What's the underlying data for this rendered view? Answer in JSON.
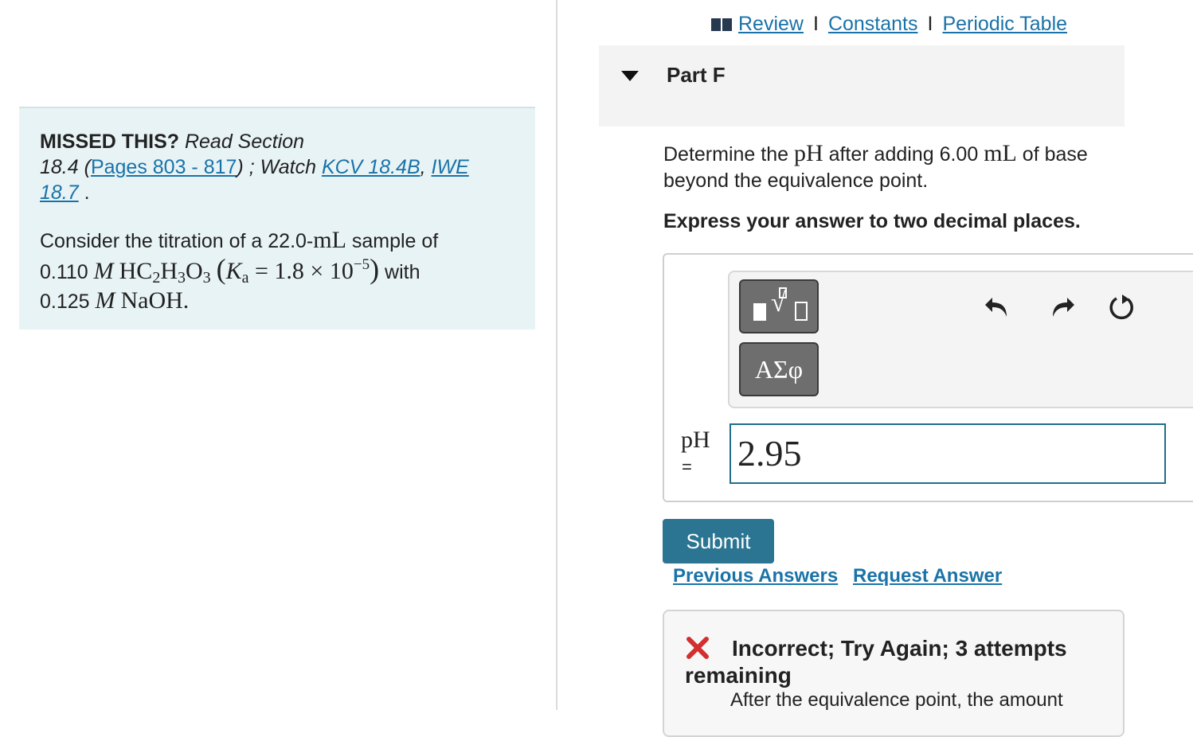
{
  "top_links": {
    "review": "Review",
    "constants": "Constants",
    "periodic_table": "Periodic Table",
    "separator": "I"
  },
  "missed": {
    "title": "MISSED THIS?",
    "read_section": "Read Section",
    "section_prefix": "18.4 (",
    "pages_link": "Pages 803 - 817",
    "section_suffix": ") ; Watch ",
    "kcv_link": "KCV 18.4B",
    "comma": ", ",
    "iwe_link_a": "IWE",
    "iwe_link_b": "18.7",
    "period": " ."
  },
  "problem": {
    "text1": "Consider the titration of a 22.0-",
    "unit_ml": "mL",
    "text2": " sample of",
    "acid_conc": "0.110",
    "molar": "M",
    "ka_expr": "= 1.8 × 10",
    "ka_exp": "−5",
    "with": " with",
    "base_conc": "0.125",
    "base": "NaOH."
  },
  "part": {
    "title": "Part F"
  },
  "question": {
    "text1": "Determine the ",
    "ph": "pH",
    "text2": " after adding 6.00 ",
    "unit": "mL",
    "text3": " of base beyond the equivalence point.",
    "instruction": "Express your answer to two decimal places."
  },
  "answer": {
    "label": "pH",
    "equals": "=",
    "value": "2.95",
    "greek_button": "ΑΣφ"
  },
  "actions": {
    "submit": "Submit",
    "previous_answers": "Previous Answers",
    "request_answer": "Request Answer"
  },
  "feedback": {
    "title": "Incorrect; Try Again; 3 attempts remaining",
    "text": "After the equivalence point, the amount"
  },
  "colors": {
    "accent": "#2b7592",
    "link": "#1a73a8",
    "error": "#d32f2f",
    "missed_bg": "#e8f3f5"
  }
}
